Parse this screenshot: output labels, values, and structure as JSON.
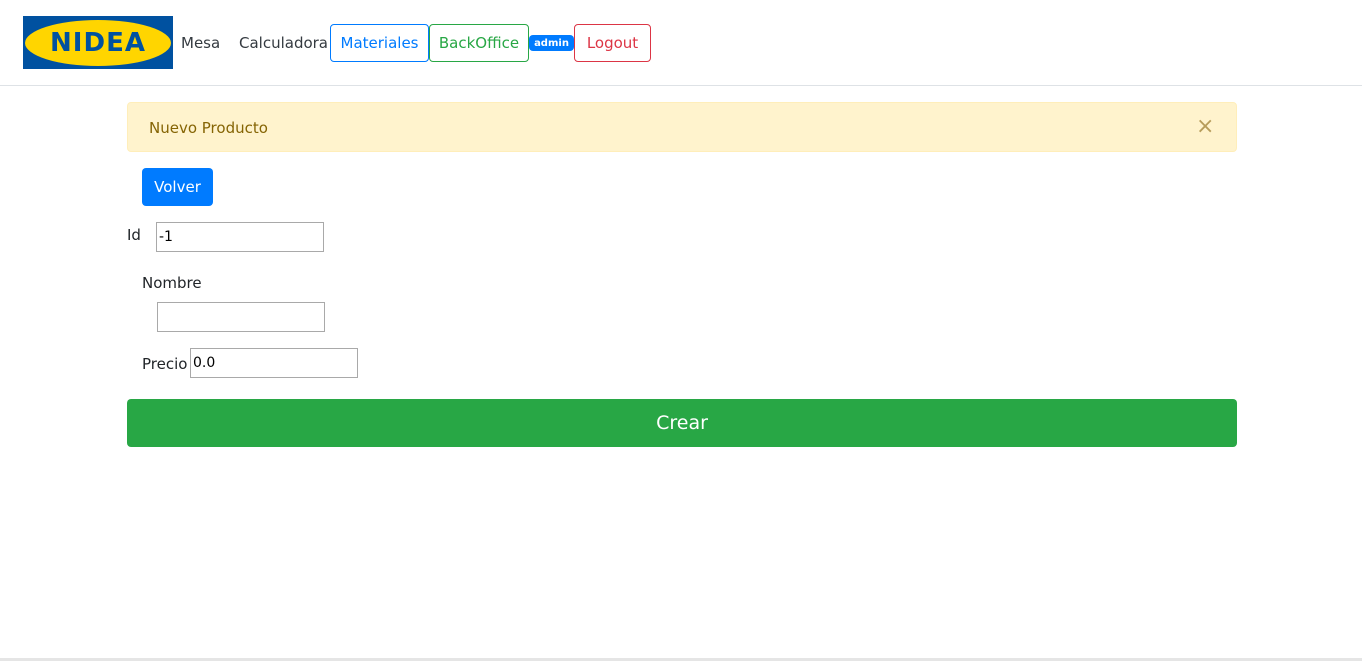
{
  "navbar": {
    "logo_text": "NIDEA",
    "links": {
      "mesa": "Mesa",
      "calculadora": "Calculadora"
    },
    "materiales_label": "Materiales",
    "backoffice_label": "BackOffice",
    "user_badge": "admin",
    "logout_label": "Logout"
  },
  "alert": {
    "message": "Nuevo Producto",
    "close_symbol": "×"
  },
  "actions": {
    "volver_label": "Volver",
    "crear_label": "Crear"
  },
  "form": {
    "id": {
      "label": "Id",
      "value": "-1"
    },
    "nombre": {
      "label": "Nombre",
      "value": ""
    },
    "precio": {
      "label": "Precio",
      "value": "0.0"
    }
  },
  "colors": {
    "primary": "#007bff",
    "success": "#28a745",
    "danger": "#dc3545",
    "warning_bg": "#fff3cd",
    "logo_blue": "#0051a0",
    "logo_yellow": "#ffd500"
  }
}
